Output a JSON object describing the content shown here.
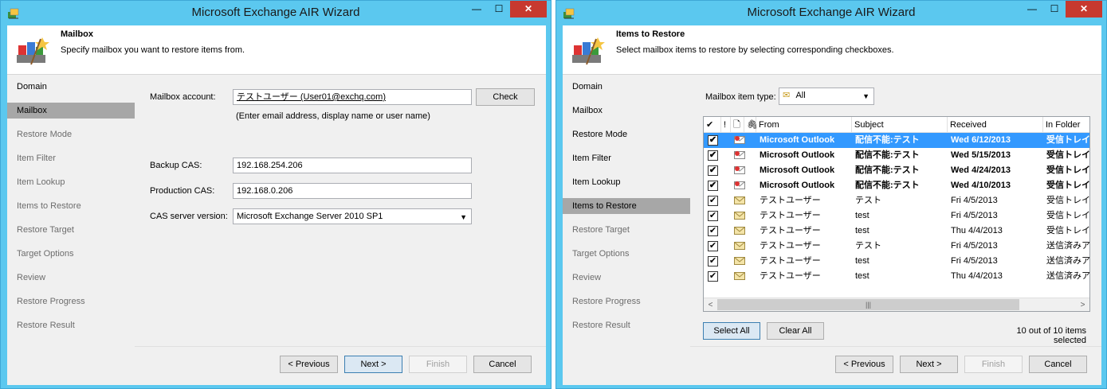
{
  "window_title": "Microsoft Exchange AIR Wizard",
  "title_buttons": {
    "minimize": "—",
    "maximize": "☐",
    "close": "✕"
  },
  "nav": [
    "Domain",
    "Mailbox",
    "Restore Mode",
    "Item Filter",
    "Item Lookup",
    "Items to Restore",
    "Restore Target",
    "Target Options",
    "Review",
    "Restore Progress",
    "Restore Result"
  ],
  "left": {
    "header_title": "Mailbox",
    "header_desc": "Specify mailbox you want to restore items from.",
    "mailbox_label": "Mailbox account:",
    "mailbox_value": "テストユーザー (User01@exchq.com)",
    "check_label": "Check",
    "hint": "(Enter email address, display name or user name)",
    "backup_cas_label": "Backup CAS:",
    "backup_cas_value": "192.168.254.206",
    "production_cas_label": "Production CAS:",
    "production_cas_value": "192.168.0.206",
    "cas_version_label": "CAS server version:",
    "cas_version_value": "Microsoft Exchange Server 2010 SP1"
  },
  "right": {
    "header_title": "Items to Restore",
    "header_desc": "Select mailbox items to restore by selecting corresponding checkboxes.",
    "item_type_label": "Mailbox item type:",
    "item_type_value": "All",
    "columns": {
      "check": "✔",
      "importance": "!",
      "type": "🗋",
      "attach": "🖇",
      "from": "From",
      "subject": "Subject",
      "received": "Received",
      "folder": "In Folder"
    },
    "rows": [
      {
        "from": "Microsoft Outlook",
        "subject": "配信不能:テスト",
        "received": "Wed 6/12/2013",
        "folder": "受信トレイ",
        "bold": true,
        "selected": true
      },
      {
        "from": "Microsoft Outlook",
        "subject": "配信不能:テスト",
        "received": "Wed 5/15/2013",
        "folder": "受信トレイ",
        "bold": true,
        "selected": false
      },
      {
        "from": "Microsoft Outlook",
        "subject": "配信不能:テスト",
        "received": "Wed 4/24/2013",
        "folder": "受信トレイ",
        "bold": true,
        "selected": false
      },
      {
        "from": "Microsoft Outlook",
        "subject": "配信不能:テスト",
        "received": "Wed 4/10/2013",
        "folder": "受信トレイ",
        "bold": true,
        "selected": false
      },
      {
        "from": "テストユーザー",
        "subject": "テスト",
        "received": "Fri 4/5/2013",
        "folder": "受信トレイ",
        "bold": false,
        "selected": false
      },
      {
        "from": "テストユーザー",
        "subject": "test",
        "received": "Fri 4/5/2013",
        "folder": "受信トレイ",
        "bold": false,
        "selected": false
      },
      {
        "from": "テストユーザー",
        "subject": "test",
        "received": "Thu 4/4/2013",
        "folder": "受信トレイ",
        "bold": false,
        "selected": false
      },
      {
        "from": "テストユーザー",
        "subject": "テスト",
        "received": "Fri 4/5/2013",
        "folder": "送信済みア",
        "bold": false,
        "selected": false
      },
      {
        "from": "テストユーザー",
        "subject": "test",
        "received": "Fri 4/5/2013",
        "folder": "送信済みア",
        "bold": false,
        "selected": false
      },
      {
        "from": "テストユーザー",
        "subject": "test",
        "received": "Thu 4/4/2013",
        "folder": "送信済みア",
        "bold": false,
        "selected": false
      }
    ],
    "select_all_label": "Select All",
    "clear_all_label": "Clear All",
    "status": "10 out of 10 items selected"
  },
  "buttons": {
    "previous": "< Previous",
    "next": "Next >",
    "finish": "Finish",
    "cancel": "Cancel"
  },
  "colors": {
    "frame": "#5bc8ef",
    "selection": "#3399ff",
    "nav_active": "#a7a7a7",
    "close": "#c7392f"
  }
}
